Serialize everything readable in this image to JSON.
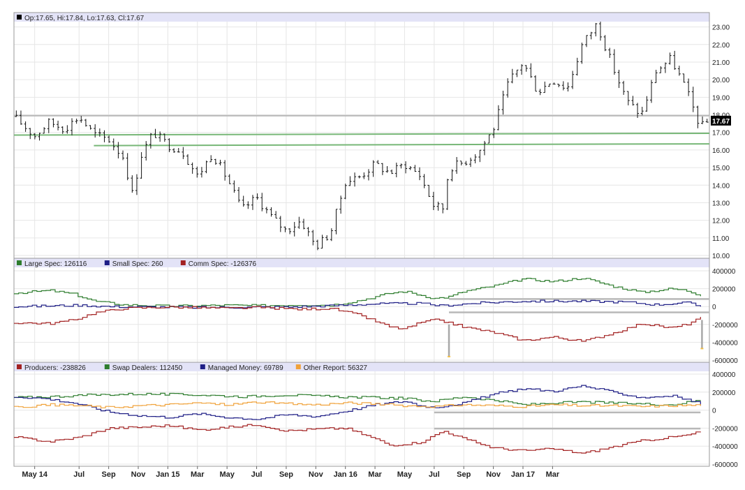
{
  "chart_data": [
    {
      "type": "bar",
      "style": "ohlc",
      "panel": "price",
      "header": "Op:17.65, Hi:17.84, Lo:17.63, Cl:17.67",
      "last_value_label": "17.67",
      "ylim": [
        10,
        23.5
      ],
      "y_ticks": [
        "23.00",
        "22.00",
        "21.00",
        "20.00",
        "19.00",
        "18.00",
        "17.00",
        "16.00",
        "15.00",
        "14.00",
        "13.00",
        "12.00",
        "11.00",
        "10.00"
      ],
      "grid": true,
      "x_range": [
        -0.2,
        23.3
      ],
      "close_anchors": [
        [
          -0.2,
          17.9
        ],
        [
          0.5,
          16.8
        ],
        [
          1.0,
          17.6
        ],
        [
          1.5,
          17.2
        ],
        [
          2.0,
          17.9
        ],
        [
          2.5,
          16.9
        ],
        [
          3.0,
          16.6
        ],
        [
          3.5,
          15.6
        ],
        [
          3.8,
          13.5
        ],
        [
          4.1,
          15.7
        ],
        [
          4.5,
          17.0
        ],
        [
          5.0,
          16.3
        ],
        [
          5.5,
          15.9
        ],
        [
          6.0,
          14.5
        ],
        [
          6.5,
          15.8
        ],
        [
          7.0,
          14.4
        ],
        [
          7.5,
          12.6
        ],
        [
          8.0,
          13.3
        ],
        [
          8.5,
          12.2
        ],
        [
          9.0,
          11.4
        ],
        [
          9.5,
          12.0
        ],
        [
          10.0,
          10.5
        ],
        [
          10.5,
          11.3
        ],
        [
          11.0,
          14.2
        ],
        [
          11.5,
          14.5
        ],
        [
          12.0,
          15.2
        ],
        [
          12.5,
          14.7
        ],
        [
          13.0,
          15.2
        ],
        [
          13.5,
          14.6
        ],
        [
          14.0,
          12.8
        ],
        [
          14.3,
          12.7
        ],
        [
          14.5,
          15.0
        ],
        [
          15.0,
          15.3
        ],
        [
          15.5,
          15.9
        ],
        [
          16.0,
          17.2
        ],
        [
          16.5,
          19.8
        ],
        [
          17.0,
          21.0
        ],
        [
          17.5,
          19.3
        ],
        [
          18.0,
          20.0
        ],
        [
          18.5,
          19.5
        ],
        [
          19.0,
          22.0
        ],
        [
          19.5,
          23.2
        ],
        [
          20.0,
          20.9
        ],
        [
          20.5,
          18.8
        ],
        [
          21.0,
          18.0
        ],
        [
          21.5,
          20.5
        ],
        [
          22.0,
          21.2
        ],
        [
          22.5,
          19.5
        ],
        [
          23.0,
          17.3
        ],
        [
          23.3,
          17.67
        ]
      ],
      "reference_lines": [
        {
          "color": "#b8b8b8",
          "from": [
            -0.2,
            17.95
          ],
          "to": [
            23.3,
            17.95
          ]
        },
        {
          "color": "#77b777",
          "from": [
            -0.2,
            16.85
          ],
          "to": [
            23.3,
            16.95
          ]
        },
        {
          "color": "#77b777",
          "from": [
            2.5,
            16.25
          ],
          "to": [
            23.3,
            16.35
          ]
        }
      ]
    },
    {
      "type": "line",
      "style": "step",
      "panel": "cot1",
      "ylim": [
        -600000,
        400000
      ],
      "y_ticks": [
        "400000",
        "200000",
        "0",
        "-200000",
        "-400000",
        "-600000"
      ],
      "grid": true,
      "series": [
        {
          "name": "Large Spec",
          "label": "Large Spec: 126116",
          "color": "#2e7d2e",
          "anchors": [
            [
              -0.2,
              150000
            ],
            [
              1.0,
              180000
            ],
            [
              1.8,
              140000
            ],
            [
              2.5,
              60000
            ],
            [
              3.5,
              20000
            ],
            [
              5.0,
              5000
            ],
            [
              7.0,
              15000
            ],
            [
              8.0,
              10000
            ],
            [
              9.5,
              20000
            ],
            [
              10.5,
              15000
            ],
            [
              11.5,
              70000
            ],
            [
              12.5,
              150000
            ],
            [
              13.0,
              170000
            ],
            [
              13.5,
              130000
            ],
            [
              14.0,
              90000
            ],
            [
              14.5,
              110000
            ],
            [
              15.0,
              170000
            ],
            [
              16.0,
              230000
            ],
            [
              17.0,
              310000
            ],
            [
              18.0,
              280000
            ],
            [
              19.0,
              320000
            ],
            [
              20.0,
              230000
            ],
            [
              21.0,
              160000
            ],
            [
              22.0,
              200000
            ],
            [
              22.5,
              180000
            ],
            [
              23.0,
              126116
            ]
          ]
        },
        {
          "name": "Small Spec",
          "label": "Small Spec: 260",
          "color": "#1f1f86",
          "anchors": [
            [
              -0.2,
              0
            ],
            [
              2.0,
              15000
            ],
            [
              3.0,
              0
            ],
            [
              6.0,
              -10000
            ],
            [
              9.0,
              -5000
            ],
            [
              10.5,
              10000
            ],
            [
              12.0,
              30000
            ],
            [
              13.5,
              35000
            ],
            [
              14.2,
              10000
            ],
            [
              15.5,
              40000
            ],
            [
              17.0,
              60000
            ],
            [
              19.0,
              60000
            ],
            [
              20.5,
              50000
            ],
            [
              21.5,
              20000
            ],
            [
              22.5,
              45000
            ],
            [
              23.0,
              260
            ]
          ]
        },
        {
          "name": "Comm Spec",
          "label": "Comm Spec: -126376",
          "color": "#a32222",
          "anchors": [
            [
              -0.2,
              -180000
            ],
            [
              1.0,
              -190000
            ],
            [
              1.8,
              -150000
            ],
            [
              2.5,
              -70000
            ],
            [
              3.5,
              -20000
            ],
            [
              5.0,
              -5000
            ],
            [
              7.0,
              -20000
            ],
            [
              8.0,
              -10000
            ],
            [
              9.5,
              -30000
            ],
            [
              10.5,
              -20000
            ],
            [
              11.5,
              -100000
            ],
            [
              12.5,
              -230000
            ],
            [
              13.0,
              -250000
            ],
            [
              13.5,
              -180000
            ],
            [
              14.0,
              -150000
            ],
            [
              14.5,
              -180000
            ],
            [
              15.0,
              -230000
            ],
            [
              16.0,
              -290000
            ],
            [
              17.0,
              -380000
            ],
            [
              18.0,
              -340000
            ],
            [
              19.0,
              -390000
            ],
            [
              20.0,
              -300000
            ],
            [
              21.0,
              -190000
            ],
            [
              22.0,
              -240000
            ],
            [
              22.5,
              -200000
            ],
            [
              23.0,
              -126376
            ]
          ]
        }
      ],
      "reference_lines": [
        {
          "color": "#b8b8b8",
          "from": [
            14.5,
            85000
          ],
          "to": [
            23.3,
            85000
          ]
        },
        {
          "color": "#b8b8b8",
          "from": [
            14.5,
            -65000
          ],
          "to": [
            23.3,
            -65000
          ]
        }
      ],
      "markers": [
        {
          "x": 14.5,
          "from": -200000,
          "to": -560000,
          "color": "#a8a8a8"
        },
        {
          "x": 23.05,
          "from": -150000,
          "to": -470000,
          "color": "#a8a8a8"
        }
      ]
    },
    {
      "type": "line",
      "style": "step",
      "panel": "cot2",
      "ylim": [
        -600000,
        400000
      ],
      "y_ticks": [
        "400000",
        "200000",
        "0",
        "-200000",
        "-400000",
        "-600000"
      ],
      "grid": true,
      "series": [
        {
          "name": "Producers",
          "label": "Producers: -238826",
          "color": "#a32222",
          "anchors": [
            [
              -0.2,
              -300000
            ],
            [
              1.0,
              -350000
            ],
            [
              2.0,
              -300000
            ],
            [
              3.0,
              -200000
            ],
            [
              4.0,
              -190000
            ],
            [
              5.0,
              -170000
            ],
            [
              6.0,
              -220000
            ],
            [
              7.0,
              -190000
            ],
            [
              8.0,
              -160000
            ],
            [
              9.0,
              -230000
            ],
            [
              10.0,
              -210000
            ],
            [
              11.0,
              -200000
            ],
            [
              12.0,
              -320000
            ],
            [
              12.5,
              -390000
            ],
            [
              13.5,
              -360000
            ],
            [
              14.3,
              -230000
            ],
            [
              15.0,
              -320000
            ],
            [
              16.0,
              -420000
            ],
            [
              17.0,
              -450000
            ],
            [
              18.0,
              -430000
            ],
            [
              19.0,
              -480000
            ],
            [
              20.0,
              -410000
            ],
            [
              21.0,
              -340000
            ],
            [
              22.0,
              -300000
            ],
            [
              22.5,
              -280000
            ],
            [
              23.0,
              -238826
            ]
          ]
        },
        {
          "name": "Swap Dealers",
          "label": "Swap Dealers: 112450",
          "color": "#2e7d2e",
          "anchors": [
            [
              -0.2,
              140000
            ],
            [
              1.0,
              150000
            ],
            [
              2.5,
              170000
            ],
            [
              4.0,
              180000
            ],
            [
              6.0,
              170000
            ],
            [
              7.5,
              150000
            ],
            [
              9.0,
              170000
            ],
            [
              10.5,
              150000
            ],
            [
              12.0,
              140000
            ],
            [
              13.0,
              130000
            ],
            [
              13.5,
              110000
            ],
            [
              14.0,
              100000
            ],
            [
              15.0,
              150000
            ],
            [
              16.0,
              110000
            ],
            [
              17.0,
              60000
            ],
            [
              18.0,
              80000
            ],
            [
              19.0,
              90000
            ],
            [
              20.0,
              80000
            ],
            [
              21.0,
              70000
            ],
            [
              22.0,
              60000
            ],
            [
              23.0,
              112450
            ]
          ]
        },
        {
          "name": "Managed Money",
          "label": "Managed Money: 69789",
          "color": "#1f1f86",
          "anchors": [
            [
              -0.2,
              150000
            ],
            [
              0.8,
              130000
            ],
            [
              1.8,
              80000
            ],
            [
              3.0,
              -20000
            ],
            [
              4.0,
              -60000
            ],
            [
              5.0,
              -80000
            ],
            [
              6.0,
              -40000
            ],
            [
              7.0,
              -80000
            ],
            [
              8.0,
              -100000
            ],
            [
              9.0,
              -50000
            ],
            [
              10.0,
              -70000
            ],
            [
              11.0,
              -10000
            ],
            [
              12.0,
              60000
            ],
            [
              13.0,
              100000
            ],
            [
              13.5,
              50000
            ],
            [
              14.0,
              30000
            ],
            [
              15.0,
              80000
            ],
            [
              16.0,
              180000
            ],
            [
              17.0,
              240000
            ],
            [
              18.0,
              210000
            ],
            [
              19.0,
              270000
            ],
            [
              20.0,
              200000
            ],
            [
              21.0,
              140000
            ],
            [
              22.0,
              160000
            ],
            [
              22.5,
              120000
            ],
            [
              23.0,
              69789
            ]
          ]
        },
        {
          "name": "Other Report",
          "label": "Other Report: 56327",
          "color": "#f0a23a",
          "anchors": [
            [
              -0.2,
              30000
            ],
            [
              1.0,
              60000
            ],
            [
              2.0,
              50000
            ],
            [
              3.0,
              30000
            ],
            [
              4.0,
              50000
            ],
            [
              5.0,
              60000
            ],
            [
              6.0,
              80000
            ],
            [
              7.0,
              60000
            ],
            [
              8.0,
              90000
            ],
            [
              9.0,
              70000
            ],
            [
              10.0,
              60000
            ],
            [
              11.0,
              80000
            ],
            [
              12.0,
              70000
            ],
            [
              13.0,
              50000
            ],
            [
              14.0,
              40000
            ],
            [
              15.0,
              60000
            ],
            [
              16.0,
              50000
            ],
            [
              17.0,
              40000
            ],
            [
              18.0,
              60000
            ],
            [
              19.0,
              50000
            ],
            [
              20.0,
              50000
            ],
            [
              21.0,
              40000
            ],
            [
              22.0,
              50000
            ],
            [
              23.0,
              56327
            ]
          ]
        }
      ],
      "reference_lines": [
        {
          "color": "#b8b8b8",
          "from": [
            14.0,
            -25000
          ],
          "to": [
            23.0,
            -25000
          ]
        },
        {
          "color": "#b8b8b8",
          "from": [
            14.0,
            -205000
          ],
          "to": [
            23.0,
            -205000
          ]
        }
      ]
    }
  ],
  "x_axis": {
    "labels": [
      "May 14",
      "Jul",
      "Sep",
      "Nov",
      "Jan 15",
      "Mar",
      "May",
      "Jul",
      "Sep",
      "Nov",
      "Jan 16",
      "Mar",
      "May",
      "Jul",
      "Sep",
      "Nov",
      "Jan 17",
      "Mar"
    ],
    "positions": [
      0.5,
      2.0,
      3.0,
      4.0,
      5.0,
      6.0,
      7.0,
      8.0,
      9.0,
      10.0,
      11.0,
      12.0,
      13.0,
      14.0,
      15.0,
      16.0,
      17.0,
      18.0
    ]
  },
  "colors": {
    "background": "#ffffff",
    "header_band": "#e3e3f7",
    "grid": "#e6e6e6",
    "price_bar": "#111111",
    "last_label_bg": "#000000"
  }
}
